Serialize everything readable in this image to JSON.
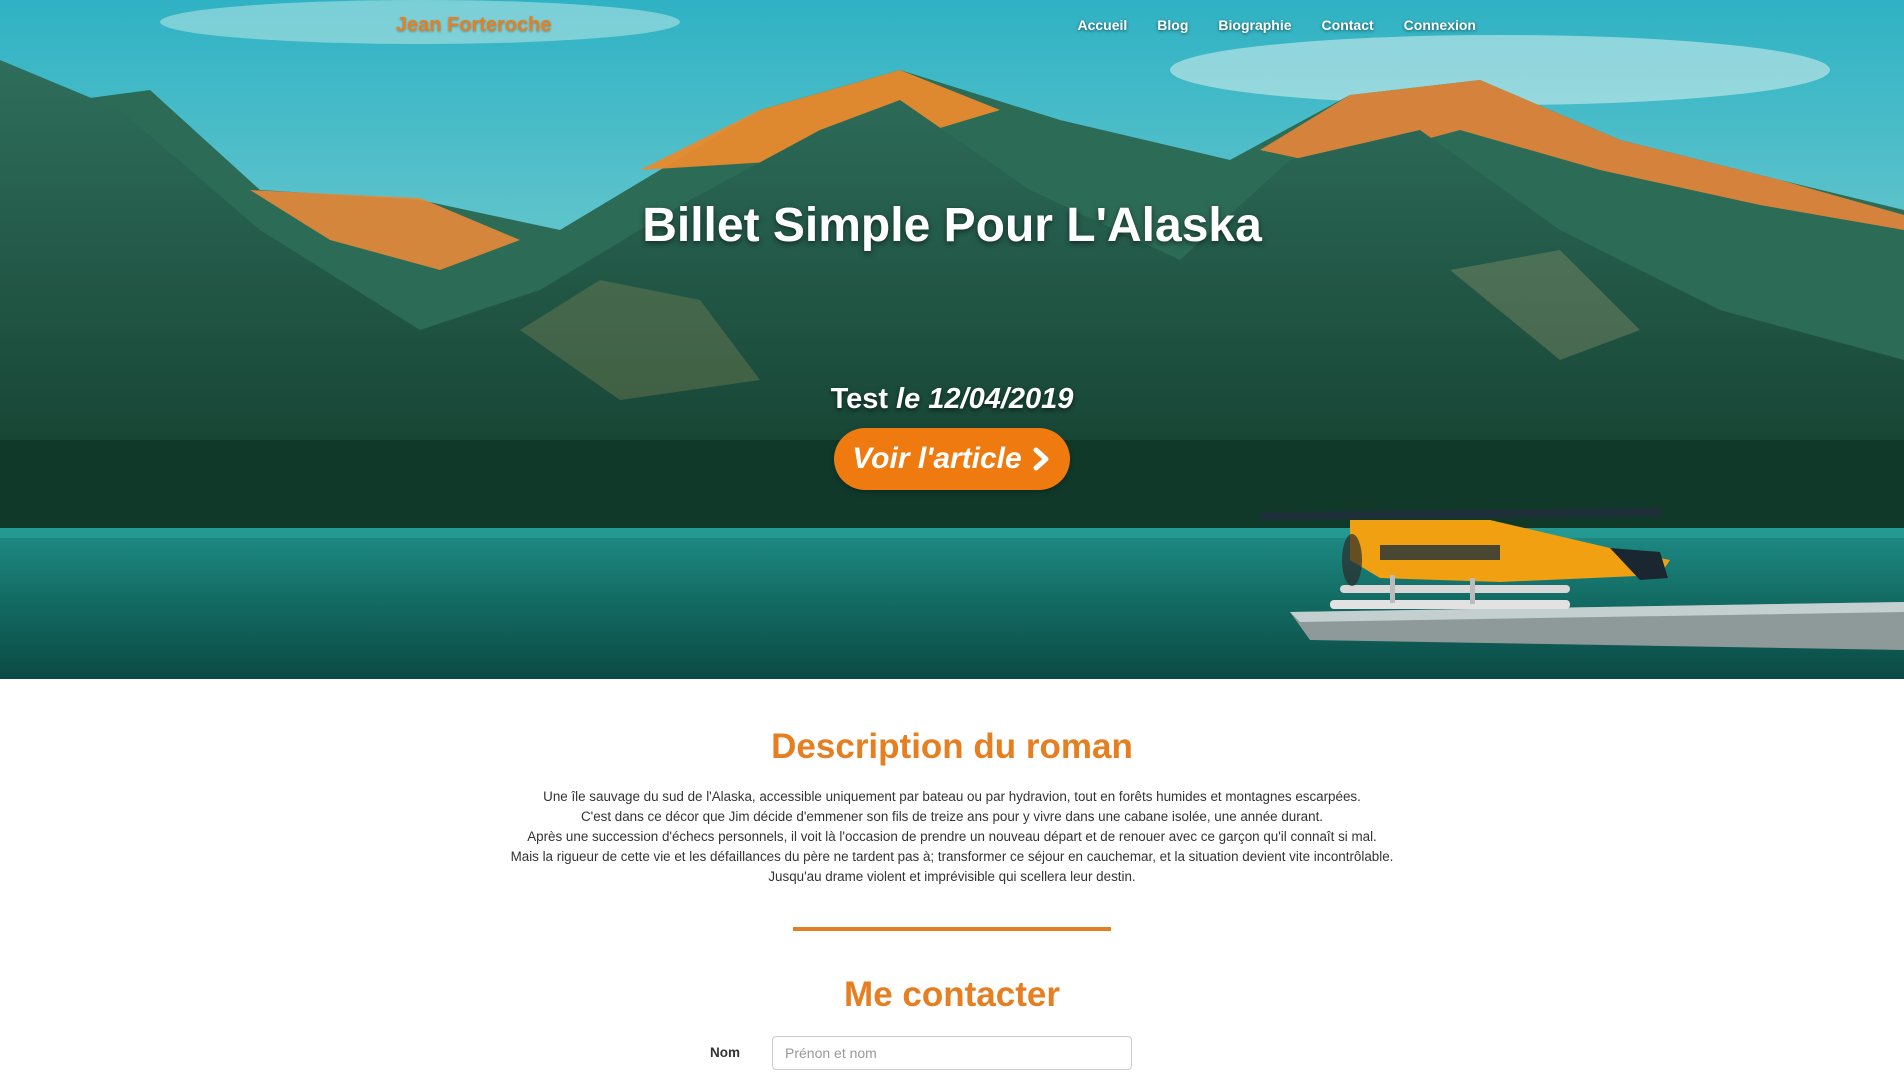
{
  "navbar": {
    "brand": "Jean Forteroche",
    "links": [
      "Accueil",
      "Blog",
      "Biographie",
      "Contact",
      "Connexion"
    ]
  },
  "hero": {
    "title": "Billet Simple Pour L'Alaska",
    "post_title": "Test",
    "post_date": "le 12/04/2019",
    "cta_label": "Voir l'article"
  },
  "description": {
    "title": "Description du roman",
    "lines": [
      "Une île sauvage du sud de l'Alaska, accessible uniquement par bateau ou par hydravion, tout en forêts humides et montagnes escarpées.",
      "C'est dans ce décor que Jim décide d'emmener son fils de treize ans pour y vivre dans une cabane isolée, une année durant.",
      "Après une succession d'échecs personnels, il voit là l'occasion de prendre un nouveau départ et de renouer avec ce garçon qu'il connaît si mal.",
      "Mais la rigueur de cette vie et les défaillances du père ne tardent pas à; transformer ce séjour en cauchemar, et la situation devient vite incontrôlable.",
      "Jusqu'au drame violent et imprévisible qui scellera leur destin."
    ]
  },
  "contact": {
    "title": "Me contacter",
    "name_label": "Nom",
    "name_placeholder": "Prénon et nom"
  },
  "colors": {
    "accent": "#e67e22",
    "button": "#ef7a0f",
    "text": "#333333"
  }
}
